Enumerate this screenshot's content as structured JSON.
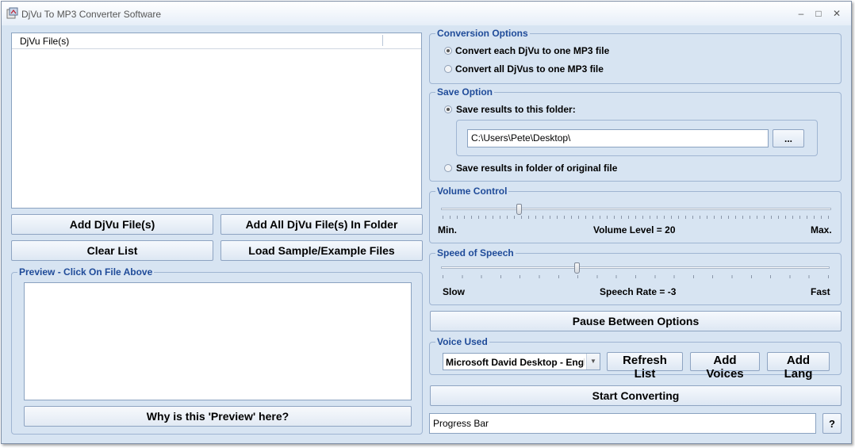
{
  "window": {
    "title": "DjVu To MP3 Converter Software",
    "minimize": "‒",
    "restore": "□",
    "close": "✕"
  },
  "file_list": {
    "column_header": "DjVu File(s)"
  },
  "buttons": {
    "add_files": "Add DjVu File(s)",
    "add_folder": "Add All DjVu File(s) In Folder",
    "clear_list": "Clear List",
    "load_samples": "Load Sample/Example Files",
    "why_preview": "Why is this 'Preview' here?",
    "pause_between": "Pause Between Options",
    "refresh_list": "Refresh List",
    "add_voices": "Add Voices",
    "add_lang": "Add Lang",
    "start_converting": "Start Converting",
    "browse": "...",
    "help": "?"
  },
  "preview": {
    "title": "Preview - Click On File Above"
  },
  "conversion_options": {
    "title": "Conversion Options",
    "option_each": "Convert each DjVu to one MP3 file",
    "option_all": "Convert all DjVus to one MP3 file",
    "selected": "each"
  },
  "save_option": {
    "title": "Save Option",
    "option_folder": "Save results to this folder:",
    "folder_path": "C:\\Users\\Pete\\Desktop\\",
    "option_original": "Save results in folder of original file",
    "selected": "folder"
  },
  "volume": {
    "title": "Volume Control",
    "min_label": "Min.",
    "max_label": "Max.",
    "level_label": "Volume Level = 20",
    "level_fraction": 0.2
  },
  "speed": {
    "title": "Speed of Speech",
    "slow_label": "Slow",
    "fast_label": "Fast",
    "rate_label": "Speech Rate = -3",
    "rate_value": -3,
    "rate_min": -10,
    "rate_max": 10
  },
  "voice": {
    "title": "Voice Used",
    "selected": "Microsoft David Desktop - English (United States)"
  },
  "progress": {
    "label": "Progress Bar"
  },
  "colors": {
    "group_title": "#1f4b99",
    "background": "#d7e4f2"
  }
}
